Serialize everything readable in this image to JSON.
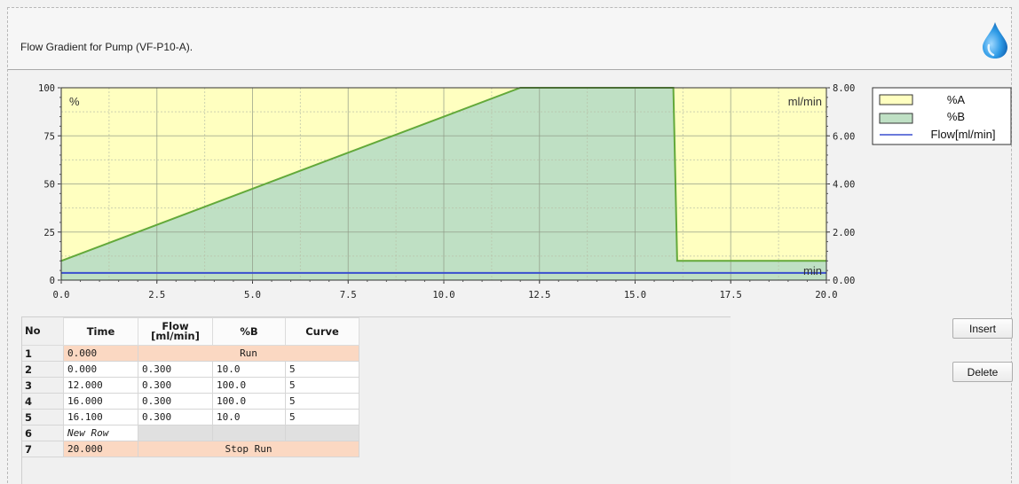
{
  "window": {
    "title": "Flow Gradient for Pump (VF-P10-A)."
  },
  "icons": {
    "header": "water-drop-icon"
  },
  "colors": {
    "area_a": "#ffffc0",
    "area_b": "#bfe0c4",
    "gradient_line": "#63a93a",
    "flow_line": "#3a4fcf",
    "row_highlight": "#fbd8c2"
  },
  "chart_data": {
    "type": "area",
    "x_label": "min",
    "y_label_left": "%",
    "y_label_right": "ml/min",
    "xlim": [
      0,
      20
    ],
    "ylim_left": [
      0,
      100
    ],
    "ylim_right": [
      0,
      8
    ],
    "x_ticks": [
      "0.0",
      "2.5",
      "5.0",
      "7.5",
      "10.0",
      "12.5",
      "15.0",
      "17.5",
      "20.0"
    ],
    "y_ticks_left": [
      "0",
      "25",
      "50",
      "75",
      "100"
    ],
    "y_ticks_right": [
      "0.00",
      "2.00",
      "4.00",
      "6.00",
      "8.00"
    ],
    "grid": true,
    "legend_position": "top-right",
    "series": [
      {
        "name": "%A",
        "kind": "area"
      },
      {
        "name": "%B",
        "kind": "area",
        "x": [
          0,
          12,
          16,
          16.1,
          20
        ],
        "y": [
          10,
          100,
          100,
          10,
          10
        ]
      },
      {
        "name": "Flow[ml/min]",
        "kind": "line",
        "x": [
          0,
          20
        ],
        "y": [
          0.3,
          0.3
        ]
      }
    ]
  },
  "table": {
    "headers": {
      "no": "No",
      "time": "Time",
      "flow": "Flow\n[ml/min]",
      "pctb": "%B",
      "curve": "Curve"
    },
    "rows": [
      {
        "no": "1",
        "time": "0.000",
        "merged": "Run"
      },
      {
        "no": "2",
        "time": "0.000",
        "flow": "0.300",
        "pctb": "10.0",
        "curve": "5"
      },
      {
        "no": "3",
        "time": "12.000",
        "flow": "0.300",
        "pctb": "100.0",
        "curve": "5"
      },
      {
        "no": "4",
        "time": "16.000",
        "flow": "0.300",
        "pctb": "100.0",
        "curve": "5"
      },
      {
        "no": "5",
        "time": "16.100",
        "flow": "0.300",
        "pctb": "10.0",
        "curve": "5"
      },
      {
        "no": "6",
        "time": "New Row"
      },
      {
        "no": "7",
        "time": "20.000",
        "merged": "Stop Run"
      }
    ]
  },
  "buttons": {
    "insert": "Insert",
    "delete": "Delete"
  }
}
